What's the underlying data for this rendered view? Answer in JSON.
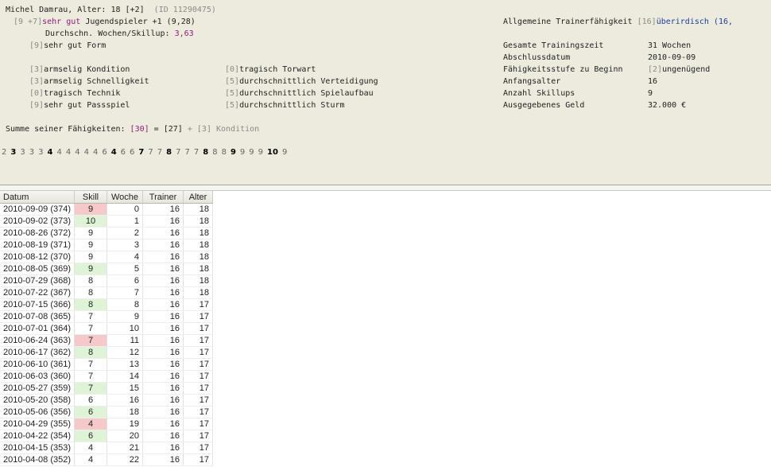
{
  "player": {
    "header_name": "Michel Damrau, Alter: 18",
    "header_age_change": "[+2]",
    "header_id": "(ID 11290475)",
    "spec_bracket": "[9 +7]",
    "spec_level": "sehr gut",
    "spec_text": "Jugendspieler +1 (9,28)",
    "avg_label": "Durchschn. Wochen/Skillup:",
    "avg_value": "3,63",
    "form_bracket": "[9]",
    "form_text": "sehr gut Form",
    "skills": [
      {
        "bracket": "[3]",
        "text": "armselig Kondition"
      },
      {
        "bracket": "[0]",
        "text": "tragisch Torwart"
      },
      {
        "bracket": "[3]",
        "text": "armselig Schnelligkeit"
      },
      {
        "bracket": "[5]",
        "text": "durchschnittlich Verteidigung"
      },
      {
        "bracket": "[0]",
        "text": "tragisch Technik"
      },
      {
        "bracket": "[5]",
        "text": "durchschnittlich Spielaufbau"
      },
      {
        "bracket": "[9]",
        "text": "sehr gut Passspiel"
      },
      {
        "bracket": "[5]",
        "text": "durchschnittlich Sturm"
      }
    ],
    "sum_label": "Summe seiner Fähigkeiten:",
    "sum_total": "[30]",
    "sum_eq": "=",
    "sum_main": "[27]",
    "sum_plus": "+ [3] Kondition"
  },
  "trainer": {
    "ability_label": "Allgemeine Trainerfähigkeit",
    "ability_bracket": "[16]",
    "ability_value": "überirdisch (16,",
    "rows": [
      {
        "label": "Gesamte Trainingszeit",
        "value": "31 Wochen"
      },
      {
        "label": "Abschlussdatum",
        "value": "2010-09-09"
      },
      {
        "label": "Fähigkeitsstufe zu Beginn",
        "value_bracket": "[2]",
        "value": "ungenügend"
      },
      {
        "label": "Anfangsalter",
        "value": "16"
      },
      {
        "label": "Anzahl Skillups",
        "value": "9"
      },
      {
        "label": "Ausgegebenes Geld",
        "value": "32.000 €"
      }
    ]
  },
  "history": [
    "2",
    "3",
    "3",
    "3",
    "3",
    "4",
    "4",
    "4",
    "4",
    "4",
    "4",
    "6",
    "4",
    "6",
    "6",
    "7",
    "7",
    "7",
    "8",
    "7",
    "7",
    "7",
    "8",
    "8",
    "8",
    "9",
    "9",
    "9",
    "9",
    "10",
    "9"
  ],
  "history_bold": [
    1,
    5,
    12,
    15,
    18,
    22,
    25,
    29
  ],
  "table": {
    "headers": [
      "Datum",
      "Skill",
      "Woche",
      "Trainer",
      "Alter"
    ],
    "rows": [
      [
        "2010-09-09 (374)",
        "9",
        "0",
        "16",
        "18",
        "down"
      ],
      [
        "2010-09-02 (373)",
        "10",
        "1",
        "16",
        "18",
        "up"
      ],
      [
        "2010-08-26 (372)",
        "9",
        "2",
        "16",
        "18",
        ""
      ],
      [
        "2010-08-19 (371)",
        "9",
        "3",
        "16",
        "18",
        ""
      ],
      [
        "2010-08-12 (370)",
        "9",
        "4",
        "16",
        "18",
        ""
      ],
      [
        "2010-08-05 (369)",
        "9",
        "5",
        "16",
        "18",
        "up"
      ],
      [
        "2010-07-29 (368)",
        "8",
        "6",
        "16",
        "18",
        ""
      ],
      [
        "2010-07-22 (367)",
        "8",
        "7",
        "16",
        "18",
        ""
      ],
      [
        "2010-07-15 (366)",
        "8",
        "8",
        "16",
        "17",
        "up"
      ],
      [
        "2010-07-08 (365)",
        "7",
        "9",
        "16",
        "17",
        ""
      ],
      [
        "2010-07-01 (364)",
        "7",
        "10",
        "16",
        "17",
        ""
      ],
      [
        "2010-06-24 (363)",
        "7",
        "11",
        "16",
        "17",
        "down"
      ],
      [
        "2010-06-17 (362)",
        "8",
        "12",
        "16",
        "17",
        "up"
      ],
      [
        "2010-06-10 (361)",
        "7",
        "13",
        "16",
        "17",
        ""
      ],
      [
        "2010-06-03 (360)",
        "7",
        "14",
        "16",
        "17",
        ""
      ],
      [
        "2010-05-27 (359)",
        "7",
        "15",
        "16",
        "17",
        "up"
      ],
      [
        "2010-05-20 (358)",
        "6",
        "16",
        "16",
        "17",
        ""
      ],
      [
        "2010-05-06 (356)",
        "6",
        "18",
        "16",
        "17",
        "up"
      ],
      [
        "2010-04-29 (355)",
        "4",
        "19",
        "16",
        "17",
        "down"
      ],
      [
        "2010-04-22 (354)",
        "6",
        "20",
        "16",
        "17",
        "up"
      ],
      [
        "2010-04-15 (353)",
        "4",
        "21",
        "16",
        "17",
        ""
      ],
      [
        "2010-04-08 (352)",
        "4",
        "22",
        "16",
        "17",
        ""
      ]
    ]
  }
}
